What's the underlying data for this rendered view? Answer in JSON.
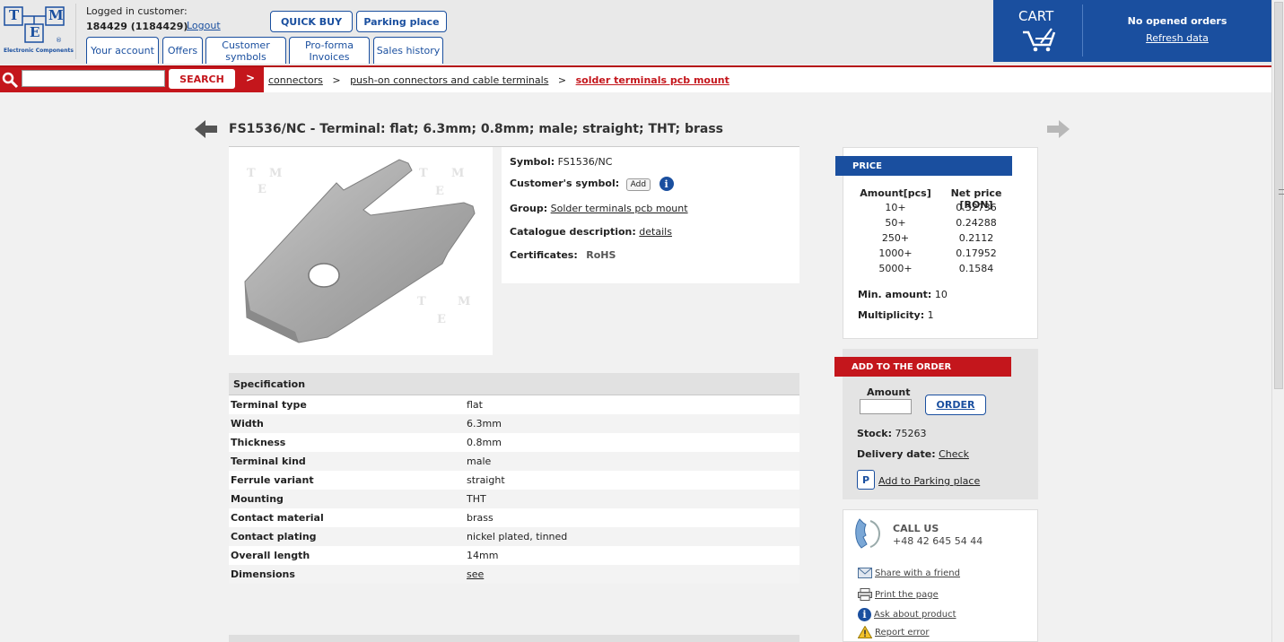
{
  "header": {
    "logo": {
      "letter_t": "T",
      "letter_m": "M",
      "letter_e": "E",
      "reg": "®",
      "tagline": "Electronic Components"
    },
    "customer_label": "Logged in customer:",
    "customer_id": "184429 (1184429)",
    "logout": "Logout",
    "quick_buy": "QUICK BUY",
    "parking_place": "Parking place",
    "tabs": [
      {
        "label": "Your account"
      },
      {
        "label": "Offers"
      },
      {
        "label": "Customer symbols"
      },
      {
        "label": "Pro-forma Invoices"
      },
      {
        "label": "Sales history"
      }
    ],
    "cart": {
      "title": "CART",
      "no_orders": "No opened orders",
      "refresh": "Refresh data"
    }
  },
  "search": {
    "button": "SEARCH",
    "value": "",
    "arrow": ">"
  },
  "breadcrumb": {
    "items": [
      "connectors",
      "push-on connectors and cable terminals",
      "solder terminals pcb mount"
    ],
    "sep": ">"
  },
  "product": {
    "title": "FS1536/NC - Terminal: flat; 6.3mm; 0.8mm; male; straight; THT; brass",
    "symbol_label": "Symbol:",
    "symbol": "FS1536/NC",
    "customer_symbol_label": "Customer's symbol:",
    "add": "Add",
    "info_glyph": "i",
    "group_label": "Group:",
    "group": "Solder terminals pcb mount",
    "catalogue_label": "Catalogue description:",
    "catalogue": "details",
    "certificates_label": "Certificates:",
    "rohs": "RoHS"
  },
  "specification": {
    "title": "Specification",
    "rows": [
      {
        "key": "Terminal type",
        "value": "flat"
      },
      {
        "key": "Width",
        "value": "6.3mm"
      },
      {
        "key": "Thickness",
        "value": "0.8mm"
      },
      {
        "key": "Terminal kind",
        "value": "male"
      },
      {
        "key": "Ferrule variant",
        "value": "straight"
      },
      {
        "key": "Mounting",
        "value": "THT"
      },
      {
        "key": "Contact material",
        "value": "brass"
      },
      {
        "key": "Contact plating",
        "value": "nickel plated, tinned"
      },
      {
        "key": "Overall length",
        "value": "14mm"
      },
      {
        "key": "Dimensions",
        "value": "see"
      }
    ]
  },
  "price": {
    "title": "PRICE",
    "col_amount": "Amount[pcs]",
    "col_price": "Net price [RON]",
    "rows": [
      {
        "amount": "10+",
        "price": "0.32736"
      },
      {
        "amount": "50+",
        "price": "0.24288"
      },
      {
        "amount": "250+",
        "price": "0.2112"
      },
      {
        "amount": "1000+",
        "price": "0.17952"
      },
      {
        "amount": "5000+",
        "price": "0.1584"
      }
    ],
    "min_label": "Min. amount:",
    "min": "10",
    "mult_label": "Multiplicity:",
    "mult": "1"
  },
  "order": {
    "title": "ADD TO THE ORDER",
    "amount_label": "Amount",
    "order_btn": "ORDER",
    "stock_label": "Stock:",
    "stock": "75263",
    "delivery_label": "Delivery date:",
    "delivery": "Check",
    "parking_badge": "P",
    "parking_link": "Add to Parking place"
  },
  "contact": {
    "call_us": "CALL US",
    "phone": "+48 42 645 54 44",
    "share": "Share with a friend",
    "print": "Print the page",
    "ask": "Ask about product",
    "report": "Report error"
  },
  "colors": {
    "brand_blue": "#1a4f9f",
    "brand_red": "#c4161c"
  }
}
